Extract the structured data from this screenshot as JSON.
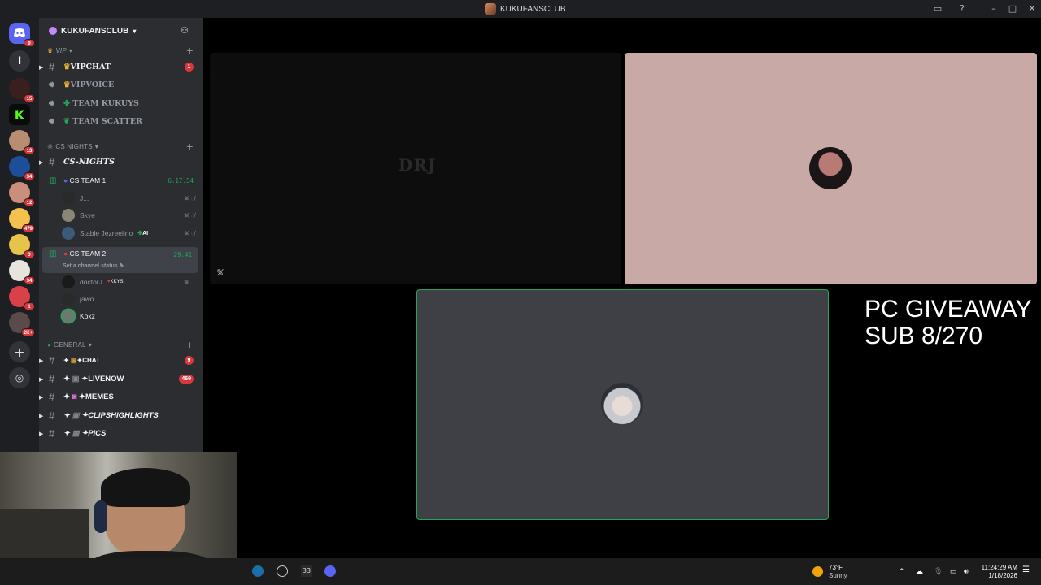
{
  "window": {
    "title": "KUKUFANSCLUB"
  },
  "rail": {
    "servers": [
      {
        "name": "discord-home",
        "badge": "9"
      },
      {
        "name": "info",
        "glyph": "i"
      },
      {
        "name": "server-a",
        "badge": "15"
      },
      {
        "name": "server-kick",
        "glyph": "K"
      },
      {
        "name": "server-c",
        "badge": "13"
      },
      {
        "name": "server-d",
        "badge": "34"
      },
      {
        "name": "server-e",
        "badge": "12"
      },
      {
        "name": "server-f",
        "badge": "479"
      },
      {
        "name": "server-g",
        "badge": "3"
      },
      {
        "name": "server-h",
        "badge": "34"
      },
      {
        "name": "server-i",
        "badge": "1"
      },
      {
        "name": "server-j",
        "badge": "2K+"
      }
    ]
  },
  "guild": {
    "name": "KUKUFANSCLUB"
  },
  "categories": {
    "vip": "VIP",
    "csnights": "CS NIGHTS",
    "general": "GENERAL"
  },
  "channels": {
    "vipchat": {
      "label": "VIPCHAT",
      "badge": "1"
    },
    "vipvoice": {
      "label": "VIPVOICE"
    },
    "teamkukuys": {
      "label": "TEAM KUKUYS"
    },
    "teamscatter": {
      "label": "TEAM SCATTER"
    },
    "csnights": {
      "label": "CS-NIGHTS"
    },
    "csteam1": {
      "label": "CS TEAM 1",
      "timer": "6:17:54"
    },
    "csteam2": {
      "label": "CS TEAM 2",
      "timer": "29:41",
      "status": "Set a channel status"
    },
    "chat": {
      "label": "✦CHAT",
      "badge": "9"
    },
    "livenow": {
      "label": "✦LIVENOW",
      "badge": "469"
    },
    "memes": {
      "label": "✦MEMES"
    },
    "clips": {
      "label": "✦CLIPSHIGHLIGHTS"
    },
    "pics": {
      "label": "✦PICS"
    }
  },
  "voice_team1": [
    {
      "name": "J...",
      "tag": ""
    },
    {
      "name": "Skye",
      "tag": ""
    },
    {
      "name": "Stable Jezreelino",
      "tag": "AI"
    }
  ],
  "voice_team2": [
    {
      "name": "doctorJ",
      "tag": "KKYS"
    },
    {
      "name": "jawo",
      "tag": ""
    },
    {
      "name": "Kokz",
      "tag": ""
    }
  ],
  "tiles": {
    "drj_text": "DRJ"
  },
  "overlay": {
    "line1": "PC GIVEAWAY",
    "line2": "SUB 8/270"
  },
  "taskbar": {
    "temperature": "73°F",
    "weather": "Sunny",
    "time": "11:24:29 AM",
    "date": "1/18/2026"
  },
  "colors": {
    "accent_green": "#23a55a",
    "badge_red": "#da373c",
    "tile_pink": "#c9a9a6",
    "tile_gray": "#3f3f46"
  }
}
